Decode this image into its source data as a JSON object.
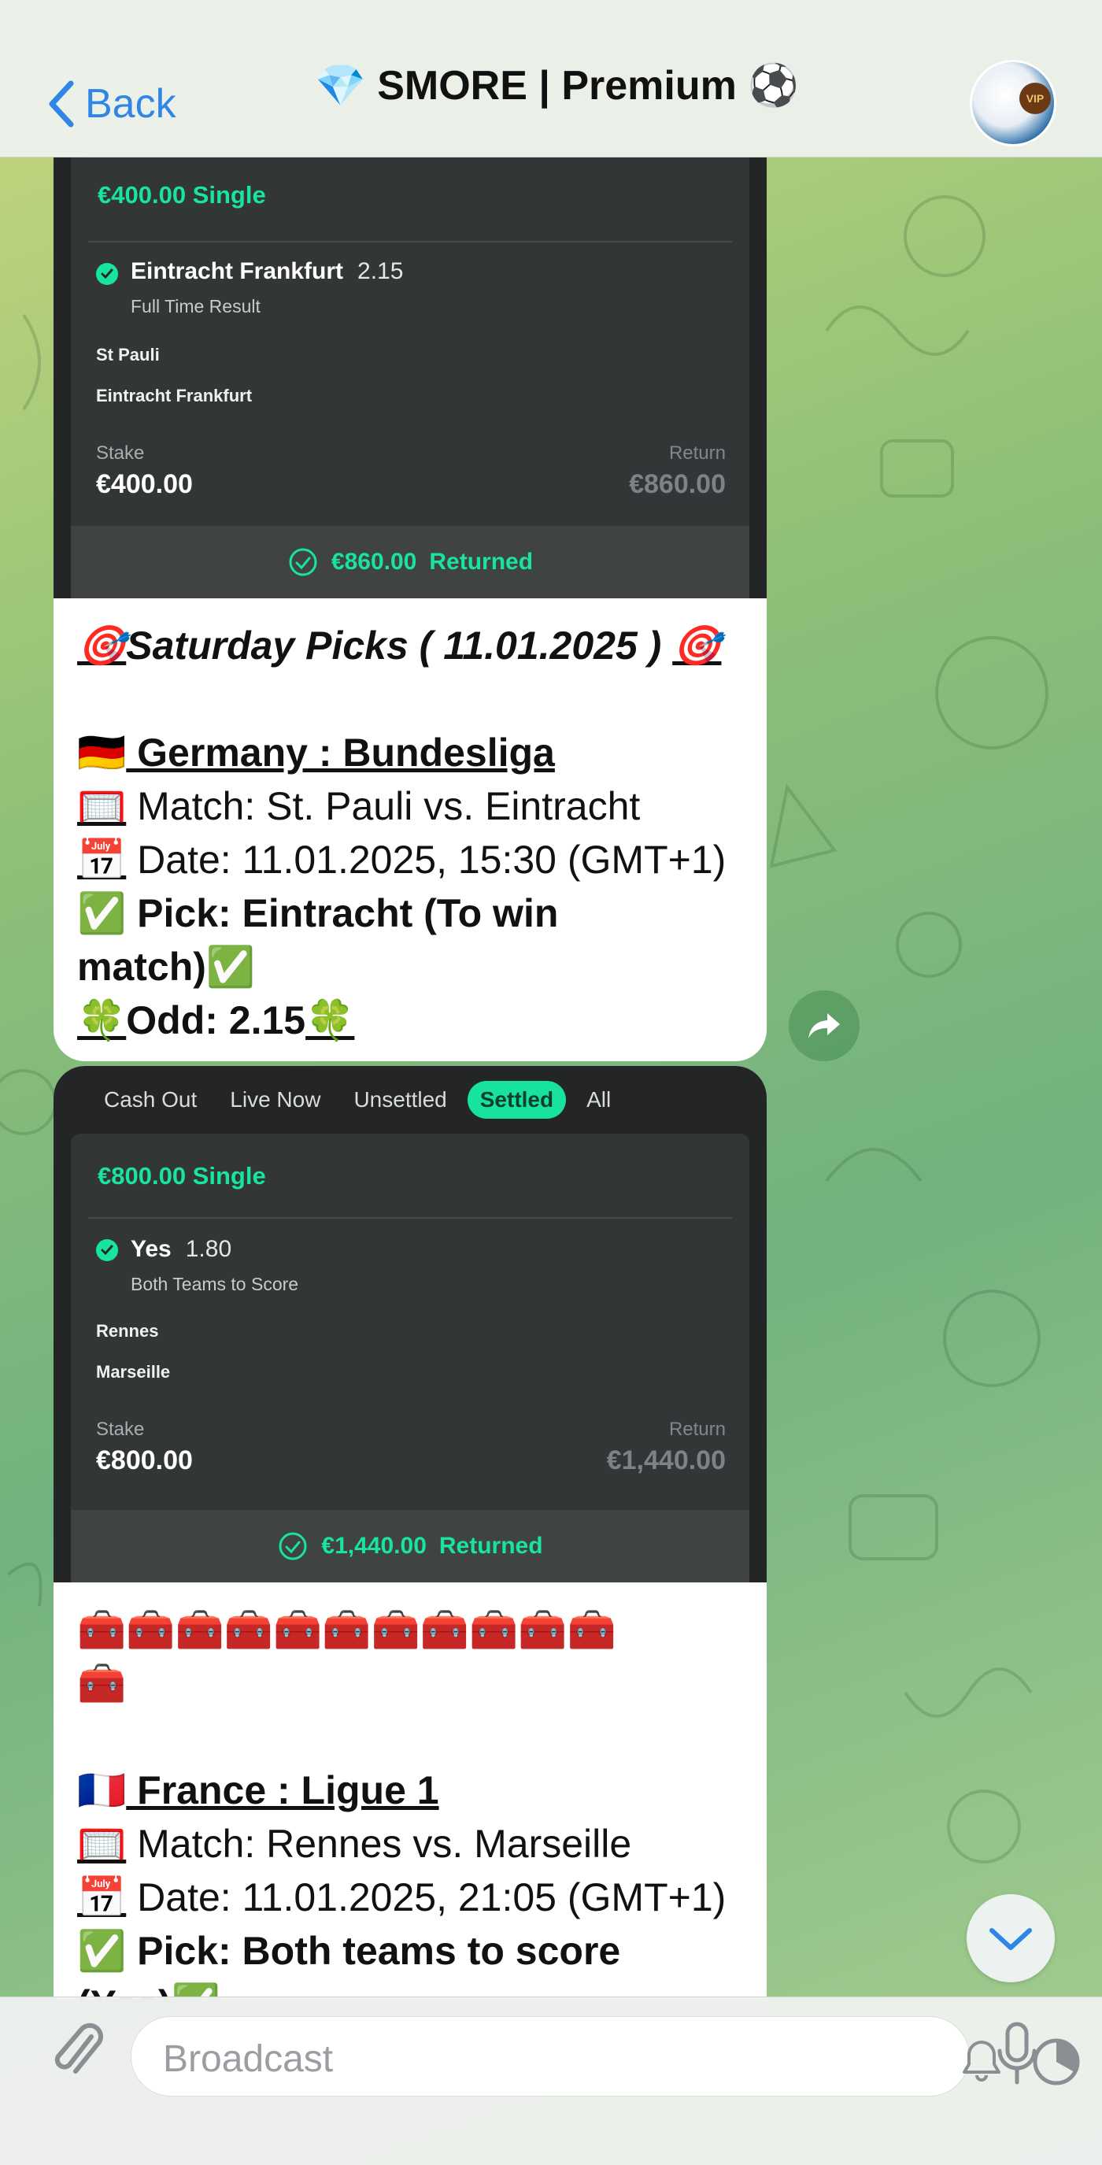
{
  "header": {
    "back_label": "Back",
    "title": "💎 SMORE | Premium ⚽",
    "avatar_badge": "VIP"
  },
  "message1": {
    "slip": {
      "single": "€400.00 Single",
      "selection": "Eintracht Frankfurt",
      "odds": "2.15",
      "market": "Full Time Result",
      "team1": "St Pauli",
      "team2": "Eintracht Frankfurt",
      "stake_label": "Stake",
      "stake": "€400.00",
      "return_label": "Return",
      "return": "€860.00",
      "footer_amount": "€860.00",
      "footer_status": "Returned"
    },
    "text": {
      "heading_emoji_left": "🎯",
      "heading": "Saturday Picks ( 11.01.2025 ) ",
      "heading_emoji_right": "🎯",
      "league_flag": "🇩🇪",
      "league": " Germany : Bundesliga",
      "match_emoji": "🥅",
      "match": " Match: St. Pauli vs. Eintracht",
      "date_emoji": "📅",
      "date": " Date: 11.01.2025, 15:30 (GMT+1)",
      "pick_emoji": "✅",
      "pick_line1": " Pick: Eintracht (To win",
      "pick_line2": "match)",
      "pick_emoji_end": "✅",
      "odd_emoji": "🍀",
      "odd": "Odd: 2.15",
      "odd_emoji_end": "🍀"
    }
  },
  "message2": {
    "tabs": [
      "Cash Out",
      "Live Now",
      "Unsettled",
      "Settled",
      "All"
    ],
    "active_tab": "Settled",
    "slip": {
      "single": "€800.00 Single",
      "selection": "Yes",
      "odds": "1.80",
      "market": "Both Teams to Score",
      "team1": "Rennes",
      "team2": "Marseille",
      "stake_label": "Stake",
      "stake": "€800.00",
      "return_label": "Return",
      "return": "€1,440.00",
      "footer_amount": "€1,440.00",
      "footer_status": "Returned"
    },
    "text": {
      "chests_line1": "🧰🧰🧰🧰🧰🧰🧰🧰🧰🧰🧰",
      "chests_line2": "🧰",
      "league_flag": "🇫🇷",
      "league": " France : Ligue 1",
      "match_emoji": "🥅",
      "match": " Match: Rennes vs. Marseille",
      "date_emoji": "📅",
      "date": " Date: 11.01.2025, 21:05 (GMT+1)",
      "pick_emoji": "✅",
      "pick_line1": " Pick: Both teams to score",
      "pick_line2": "(Yes)",
      "pick_emoji_end": "✅"
    }
  },
  "composer": {
    "placeholder": "Broadcast"
  },
  "colors": {
    "accent_green": "#19e3a0",
    "link_blue": "#2f86e6",
    "slip_bg": "#232526"
  }
}
